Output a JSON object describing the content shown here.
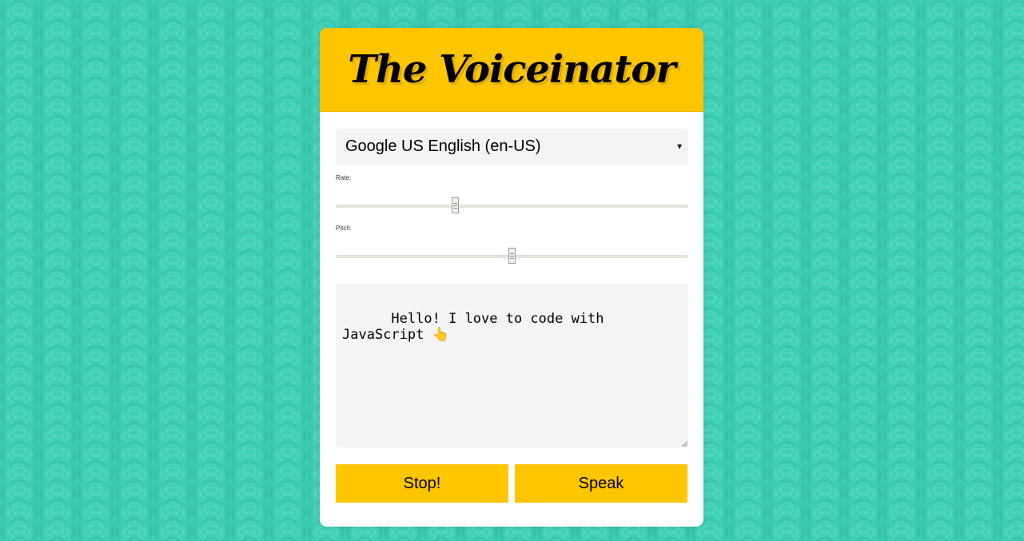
{
  "app": {
    "title": "The Voiceinator"
  },
  "voice_select": {
    "selected": "Google US English (en-US)",
    "icon": "chevron-down-icon"
  },
  "rate": {
    "label": "Rate:",
    "value_fraction": 0.34
  },
  "pitch": {
    "label": "Pitch:",
    "value_fraction": 0.5
  },
  "message": {
    "text": "Hello! I love to code with JavaScript 👆"
  },
  "buttons": {
    "stop_label": "Stop!",
    "speak_label": "Speak"
  },
  "colors": {
    "background": "#3bd0b5",
    "accent": "#ffc600",
    "field": "#f4f4f4"
  }
}
